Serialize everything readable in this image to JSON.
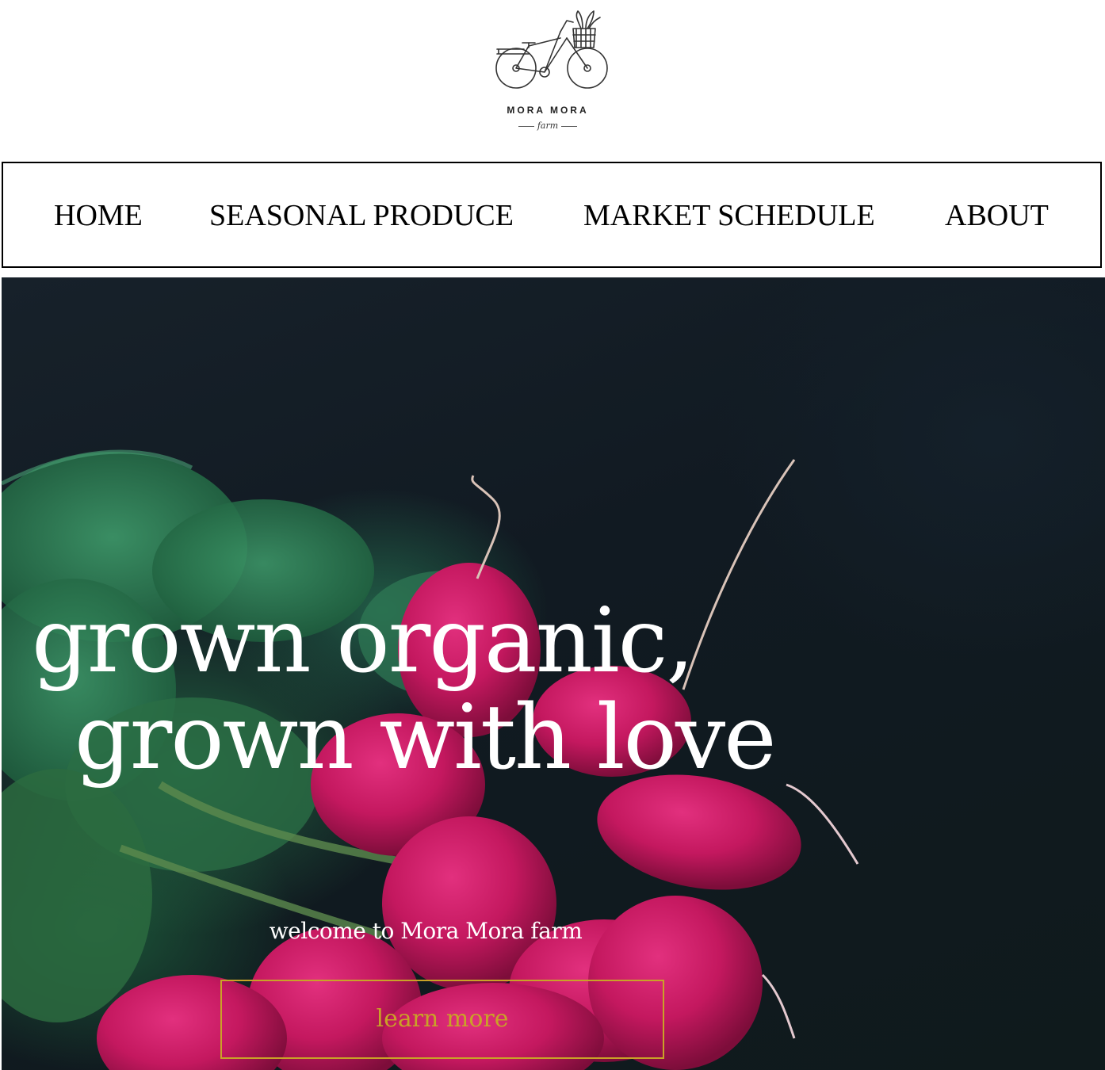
{
  "brand": {
    "name": "MORA MORA",
    "tagline": "farm",
    "logo_icon": "bicycle-with-basket-icon"
  },
  "nav": {
    "items": [
      {
        "label": "HOME"
      },
      {
        "label": "SEASONAL PRODUCE"
      },
      {
        "label": "MARKET SCHEDULE"
      },
      {
        "label": "ABOUT"
      }
    ]
  },
  "hero": {
    "headline_line1": "grown organic,",
    "headline_line2": "grown with love",
    "welcome": "welcome to Mora Mora farm",
    "cta_label": "learn more",
    "image_subject": "bunch of radishes on dark background",
    "accent_color": "#c9a227"
  }
}
